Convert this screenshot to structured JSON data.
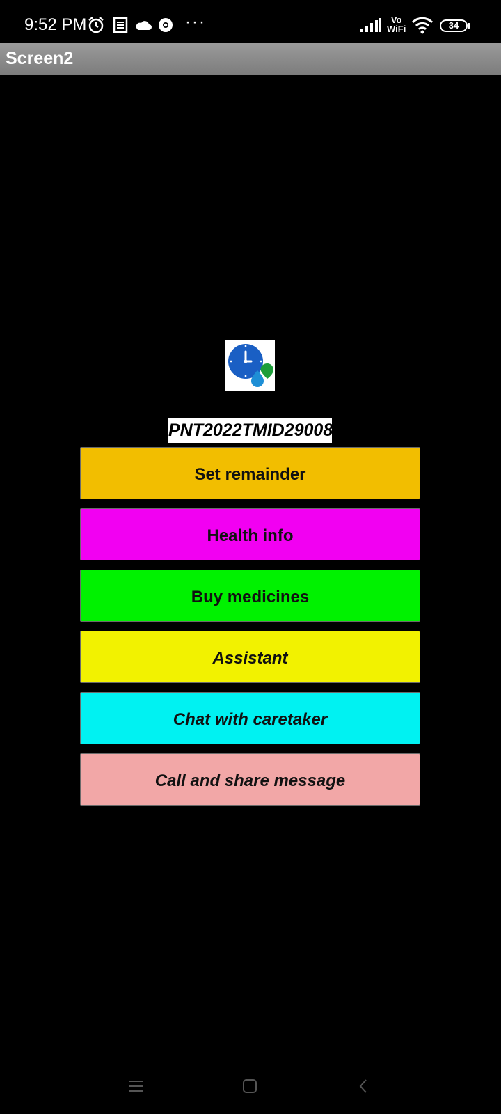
{
  "status_bar": {
    "time": "9:52 PM",
    "icons": [
      "alarm-icon",
      "news-icon",
      "cloud-icon",
      "chrome-icon",
      "more-dots-icon",
      "signal-icon",
      "vowifi-icon",
      "wifi-icon",
      "battery-icon"
    ],
    "more": "···",
    "vowifi_top": "Vo",
    "vowifi_bottom": "WiFi",
    "battery_level": "34"
  },
  "title_bar": {
    "title": "Screen2"
  },
  "logo": {
    "icon": "clock-medicine-logo-icon"
  },
  "app_id": "PNT2022TMID29008",
  "buttons": [
    {
      "label": "Set remainder",
      "color": "#F2BE00"
    },
    {
      "label": "Health info",
      "color": "#F200F2"
    },
    {
      "label": "Buy medicines",
      "color": "#00F200"
    },
    {
      "label": "Assistant",
      "color": "#F2F200"
    },
    {
      "label": "Chat with caretaker",
      "color": "#00F2F2"
    },
    {
      "label": "Call and share message",
      "color": "#F2A7A7"
    }
  ],
  "nav_bar": {
    "icons": [
      "menu-icon",
      "home-icon",
      "back-icon"
    ]
  }
}
